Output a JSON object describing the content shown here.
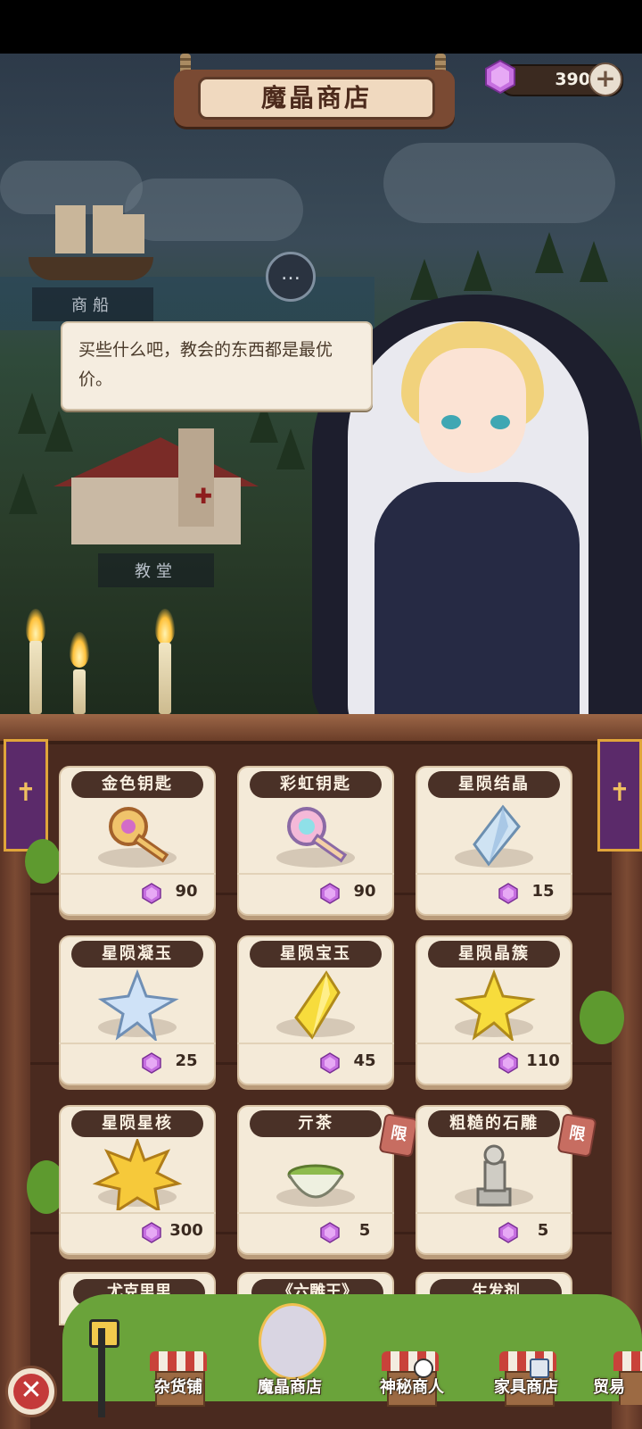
{
  "header": {
    "title": "魔晶商店",
    "currency_amount": "390",
    "currency_icon": "magic-crystal-gem",
    "add_icon": "plus-icon"
  },
  "map": {
    "locations": [
      {
        "label": "商船"
      },
      {
        "label": "教堂"
      }
    ]
  },
  "npc": {
    "dialog": "买些什么吧，教会的东西都是最优价。"
  },
  "shop": {
    "price_icon": "magic-crystal-gem",
    "limited_tag": "限",
    "items": [
      {
        "name": "金色钥匙",
        "price": "90",
        "icon": "golden-key"
      },
      {
        "name": "彩虹钥匙",
        "price": "90",
        "icon": "rainbow-key"
      },
      {
        "name": "星陨结晶",
        "price": "15",
        "icon": "meteor-crystal"
      },
      {
        "name": "星陨凝玉",
        "price": "25",
        "icon": "meteor-jade-star"
      },
      {
        "name": "星陨宝玉",
        "price": "45",
        "icon": "meteor-gem-yellow"
      },
      {
        "name": "星陨晶簇",
        "price": "110",
        "icon": "meteor-cluster-star"
      },
      {
        "name": "星陨星核",
        "price": "300",
        "icon": "meteor-star-core"
      },
      {
        "name": "亓茶",
        "price": "5",
        "icon": "tea-bowl",
        "limited": true
      },
      {
        "name": "粗糙的石雕",
        "price": "5",
        "icon": "stone-statue",
        "limited": true
      }
    ],
    "partial_items": [
      {
        "name": "尤克里里"
      },
      {
        "name": "《六雕王》"
      },
      {
        "name": "生发剂"
      }
    ]
  },
  "nav": {
    "close_icon": "close-icon",
    "tabs": [
      {
        "label": "杂货铺"
      },
      {
        "label": "魔晶商店"
      },
      {
        "label": "神秘商人"
      },
      {
        "label": "家具商店"
      },
      {
        "label": "贸易"
      }
    ]
  },
  "colors": {
    "wood_dark": "#4a2a1f",
    "card_bg": "#f4ead8",
    "name_pill": "#4a3127",
    "gem_purple": "#c66fe0",
    "limited_tag": "#c76d61"
  }
}
